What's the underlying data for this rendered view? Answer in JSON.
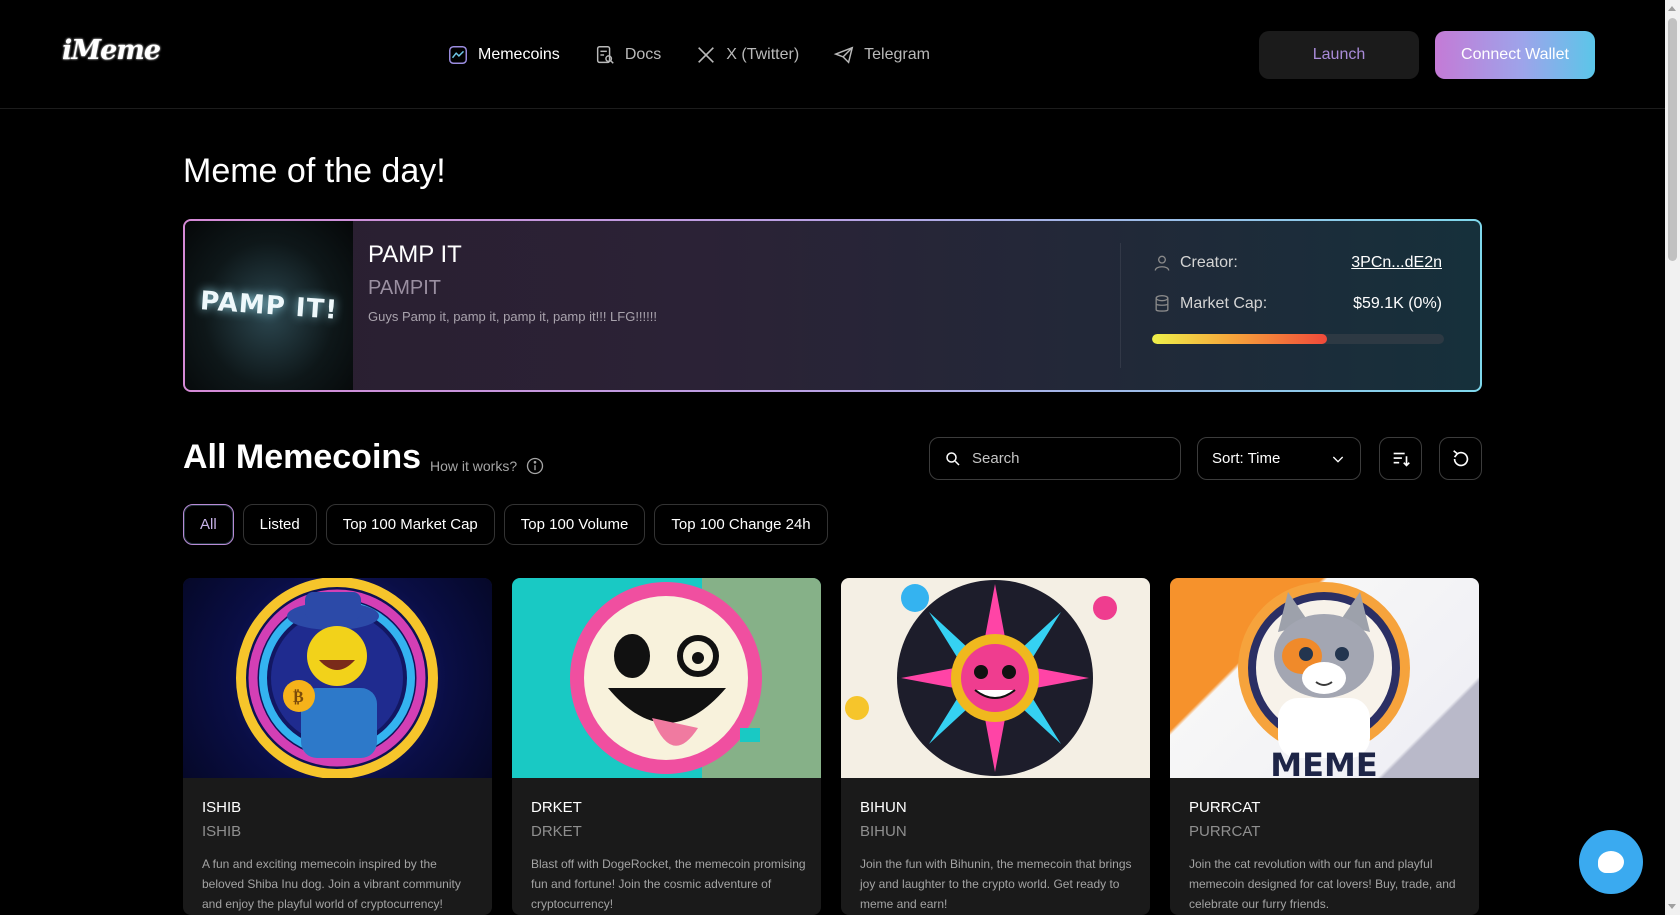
{
  "header": {
    "logo_text": "iMeme",
    "nav": [
      {
        "label": "Memecoins",
        "icon": "chart-icon",
        "active": true
      },
      {
        "label": "Docs",
        "icon": "docs-icon",
        "active": false
      },
      {
        "label": "X (Twitter)",
        "icon": "x-icon",
        "active": false
      },
      {
        "label": "Telegram",
        "icon": "telegram-icon",
        "active": false
      }
    ],
    "launch_label": "Launch",
    "connect_label": "Connect Wallet"
  },
  "featured": {
    "section_title": "Meme of the day!",
    "image_text": "PAMP IT!",
    "name": "PAMP IT",
    "ticker": "PAMPIT",
    "description": "Guys Pamp it, pamp it, pamp it, pamp it!!! LFG!!!!!!",
    "creator_label": "Creator:",
    "creator_value": "3PCn...dE2n",
    "market_cap_label": "Market Cap:",
    "market_cap_value": "$59.1K (0%)",
    "progress_percent": 60
  },
  "list": {
    "title": "All Memecoins",
    "how_it_works": "How it works?",
    "search_placeholder": "Search",
    "sort_label": "Sort: Time",
    "filters": [
      "All",
      "Listed",
      "Top 100 Market Cap",
      "Top 100 Volume",
      "Top 100 Change 24h"
    ],
    "active_filter": "All"
  },
  "cards": [
    {
      "name": "ISHIB",
      "ticker": "ISHIB",
      "description": "A fun and exciting memecoin inspired by the beloved Shiba Inu dog. Join a vibrant community and enjoy the playful world of cryptocurrency!"
    },
    {
      "name": "DRKET",
      "ticker": "DRKET",
      "description": "Blast off with DogeRocket, the memecoin promising fun and fortune! Join the cosmic adventure of cryptocurrency!"
    },
    {
      "name": "BIHUN",
      "ticker": "BIHUN",
      "description": "Join the fun with Bihunin, the memecoin that brings joy and laughter to the crypto world. Get ready to meme and earn!"
    },
    {
      "name": "PURRCAT",
      "ticker": "PURRCAT",
      "description": "Join the cat revolution with our fun and playful memecoin designed for cat lovers! Buy, trade, and celebrate our furry friends."
    }
  ],
  "colors": {
    "accent_gradient_start": "#c47ad6",
    "accent_gradient_end": "#5bc6e9",
    "chat_bubble": "#3aaaf0"
  }
}
